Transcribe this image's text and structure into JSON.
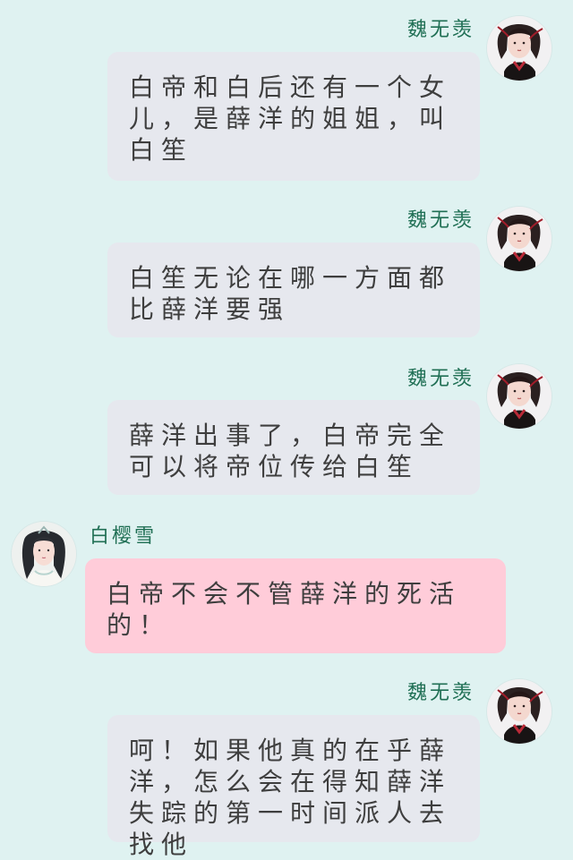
{
  "messages": [
    {
      "id": "m1",
      "side": "right",
      "sender": "魏无羡",
      "text": "白帝和白后还有一个女儿，是薛洋的姐姐，叫白笙",
      "avatar_icon": "wei-wuxian-avatar"
    },
    {
      "id": "m2",
      "side": "right",
      "sender": "魏无羡",
      "text": "白笙无论在哪一方面都比薛洋要强",
      "avatar_icon": "wei-wuxian-avatar"
    },
    {
      "id": "m3",
      "side": "right",
      "sender": "魏无羡",
      "text": "薛洋出事了，白帝完全可以将帝位传给白笙",
      "avatar_icon": "wei-wuxian-avatar"
    },
    {
      "id": "m4",
      "side": "left",
      "sender": "白樱雪",
      "text": "白帝不会不管薛洋的死活的！",
      "avatar_icon": "bai-yingxue-avatar"
    },
    {
      "id": "m5",
      "side": "right",
      "sender": "魏无羡",
      "text": "呵！如果他真的在乎薛洋，怎么会在得知薛洋失踪的第一时间派人去找他",
      "avatar_icon": "wei-wuxian-avatar"
    }
  ],
  "colors": {
    "background": "#dff2f1",
    "name": "#1f6f54",
    "gray_bubble": "#e6e8ee",
    "pink_bubble": "#ffccd9",
    "text": "#3e3e3e"
  }
}
